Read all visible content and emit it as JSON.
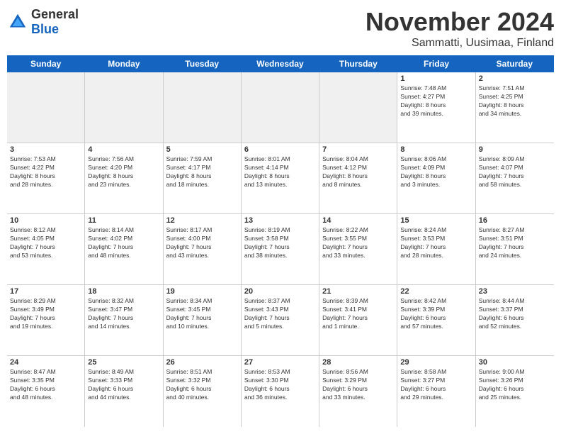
{
  "logo": {
    "general": "General",
    "blue": "Blue"
  },
  "title": "November 2024",
  "subtitle": "Sammatti, Uusimaa, Finland",
  "days_header": [
    "Sunday",
    "Monday",
    "Tuesday",
    "Wednesday",
    "Thursday",
    "Friday",
    "Saturday"
  ],
  "weeks": [
    [
      {
        "day": "",
        "info": "",
        "empty": true
      },
      {
        "day": "",
        "info": "",
        "empty": true
      },
      {
        "day": "",
        "info": "",
        "empty": true
      },
      {
        "day": "",
        "info": "",
        "empty": true
      },
      {
        "day": "",
        "info": "",
        "empty": true
      },
      {
        "day": "1",
        "info": "Sunrise: 7:48 AM\nSunset: 4:27 PM\nDaylight: 8 hours\nand 39 minutes."
      },
      {
        "day": "2",
        "info": "Sunrise: 7:51 AM\nSunset: 4:25 PM\nDaylight: 8 hours\nand 34 minutes."
      }
    ],
    [
      {
        "day": "3",
        "info": "Sunrise: 7:53 AM\nSunset: 4:22 PM\nDaylight: 8 hours\nand 28 minutes."
      },
      {
        "day": "4",
        "info": "Sunrise: 7:56 AM\nSunset: 4:20 PM\nDaylight: 8 hours\nand 23 minutes."
      },
      {
        "day": "5",
        "info": "Sunrise: 7:59 AM\nSunset: 4:17 PM\nDaylight: 8 hours\nand 18 minutes."
      },
      {
        "day": "6",
        "info": "Sunrise: 8:01 AM\nSunset: 4:14 PM\nDaylight: 8 hours\nand 13 minutes."
      },
      {
        "day": "7",
        "info": "Sunrise: 8:04 AM\nSunset: 4:12 PM\nDaylight: 8 hours\nand 8 minutes."
      },
      {
        "day": "8",
        "info": "Sunrise: 8:06 AM\nSunset: 4:09 PM\nDaylight: 8 hours\nand 3 minutes."
      },
      {
        "day": "9",
        "info": "Sunrise: 8:09 AM\nSunset: 4:07 PM\nDaylight: 7 hours\nand 58 minutes."
      }
    ],
    [
      {
        "day": "10",
        "info": "Sunrise: 8:12 AM\nSunset: 4:05 PM\nDaylight: 7 hours\nand 53 minutes."
      },
      {
        "day": "11",
        "info": "Sunrise: 8:14 AM\nSunset: 4:02 PM\nDaylight: 7 hours\nand 48 minutes."
      },
      {
        "day": "12",
        "info": "Sunrise: 8:17 AM\nSunset: 4:00 PM\nDaylight: 7 hours\nand 43 minutes."
      },
      {
        "day": "13",
        "info": "Sunrise: 8:19 AM\nSunset: 3:58 PM\nDaylight: 7 hours\nand 38 minutes."
      },
      {
        "day": "14",
        "info": "Sunrise: 8:22 AM\nSunset: 3:55 PM\nDaylight: 7 hours\nand 33 minutes."
      },
      {
        "day": "15",
        "info": "Sunrise: 8:24 AM\nSunset: 3:53 PM\nDaylight: 7 hours\nand 28 minutes."
      },
      {
        "day": "16",
        "info": "Sunrise: 8:27 AM\nSunset: 3:51 PM\nDaylight: 7 hours\nand 24 minutes."
      }
    ],
    [
      {
        "day": "17",
        "info": "Sunrise: 8:29 AM\nSunset: 3:49 PM\nDaylight: 7 hours\nand 19 minutes."
      },
      {
        "day": "18",
        "info": "Sunrise: 8:32 AM\nSunset: 3:47 PM\nDaylight: 7 hours\nand 14 minutes."
      },
      {
        "day": "19",
        "info": "Sunrise: 8:34 AM\nSunset: 3:45 PM\nDaylight: 7 hours\nand 10 minutes."
      },
      {
        "day": "20",
        "info": "Sunrise: 8:37 AM\nSunset: 3:43 PM\nDaylight: 7 hours\nand 5 minutes."
      },
      {
        "day": "21",
        "info": "Sunrise: 8:39 AM\nSunset: 3:41 PM\nDaylight: 7 hours\nand 1 minute."
      },
      {
        "day": "22",
        "info": "Sunrise: 8:42 AM\nSunset: 3:39 PM\nDaylight: 6 hours\nand 57 minutes."
      },
      {
        "day": "23",
        "info": "Sunrise: 8:44 AM\nSunset: 3:37 PM\nDaylight: 6 hours\nand 52 minutes."
      }
    ],
    [
      {
        "day": "24",
        "info": "Sunrise: 8:47 AM\nSunset: 3:35 PM\nDaylight: 6 hours\nand 48 minutes."
      },
      {
        "day": "25",
        "info": "Sunrise: 8:49 AM\nSunset: 3:33 PM\nDaylight: 6 hours\nand 44 minutes."
      },
      {
        "day": "26",
        "info": "Sunrise: 8:51 AM\nSunset: 3:32 PM\nDaylight: 6 hours\nand 40 minutes."
      },
      {
        "day": "27",
        "info": "Sunrise: 8:53 AM\nSunset: 3:30 PM\nDaylight: 6 hours\nand 36 minutes."
      },
      {
        "day": "28",
        "info": "Sunrise: 8:56 AM\nSunset: 3:29 PM\nDaylight: 6 hours\nand 33 minutes."
      },
      {
        "day": "29",
        "info": "Sunrise: 8:58 AM\nSunset: 3:27 PM\nDaylight: 6 hours\nand 29 minutes."
      },
      {
        "day": "30",
        "info": "Sunrise: 9:00 AM\nSunset: 3:26 PM\nDaylight: 6 hours\nand 25 minutes."
      }
    ]
  ]
}
